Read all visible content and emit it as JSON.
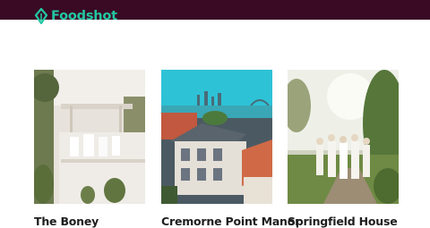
{
  "header": {
    "brand": "Foodshot",
    "brand_color": "#22c7a3",
    "bar_color": "#3a0a24",
    "logo_icon": "leaf-logo-icon"
  },
  "venues": [
    {
      "title": "The Boney",
      "image": "wedding-ceremony-photo"
    },
    {
      "title": "Cremorne Point Manor",
      "image": "harbour-mansion-photo"
    },
    {
      "title": "Springfield House",
      "image": "bridal-party-photo"
    }
  ]
}
